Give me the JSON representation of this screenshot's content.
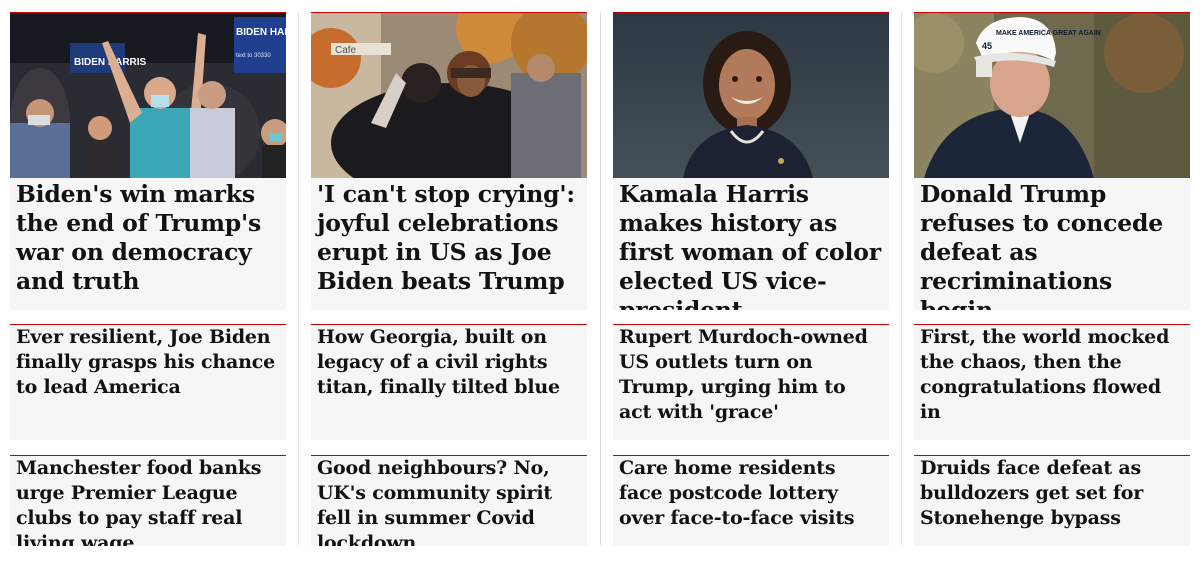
{
  "columns": [
    {
      "image_alt_icon": "crowd-celebration-photo",
      "headline": "Biden's win marks the end of Trump's war on democracy and truth",
      "stories": [
        "Ever resilient, Joe Biden finally grasps his chance to lead America",
        "Manchester food banks urge Premier League clubs to pay staff real living wage"
      ]
    },
    {
      "image_alt_icon": "hugging-people-photo",
      "headline": "'I can't stop crying': joyful celebrations erupt in US as Joe Biden beats Trump",
      "stories": [
        "How Georgia, built on legacy of a civil rights titan, finally tilted blue",
        "Good neighbours? No, UK's community spirit fell in summer Covid lockdown"
      ]
    },
    {
      "image_alt_icon": "kamala-harris-portrait-photo",
      "headline": "Kamala Harris makes history as first woman of color elected US vice-president",
      "stories": [
        "Rupert Murdoch-owned US outlets turn on Trump, urging him to act with 'grace'",
        "Care home residents face postcode lottery over face-to-face visits"
      ]
    },
    {
      "image_alt_icon": "donald-trump-portrait-photo",
      "headline": "Donald Trump refuses to concede defeat as recriminations begin",
      "stories": [
        "First, the world mocked the chaos, then the congratulations flowed in",
        "Druids face defeat as bulldozers get set for Stonehenge bypass"
      ]
    }
  ],
  "photo_text": {
    "sign_left": "BIDEN HARRIS",
    "sign_right": "BIDEN HARRIS",
    "sign_right_sub": "text to 30330",
    "storefront": "Cafe",
    "cap": "MAKE AMERICA GREAT AGAIN",
    "cap_number": "45"
  },
  "colors": {
    "accent_red": "#c70000",
    "card_bg": "#f6f6f6",
    "headline_text": "#121212"
  }
}
